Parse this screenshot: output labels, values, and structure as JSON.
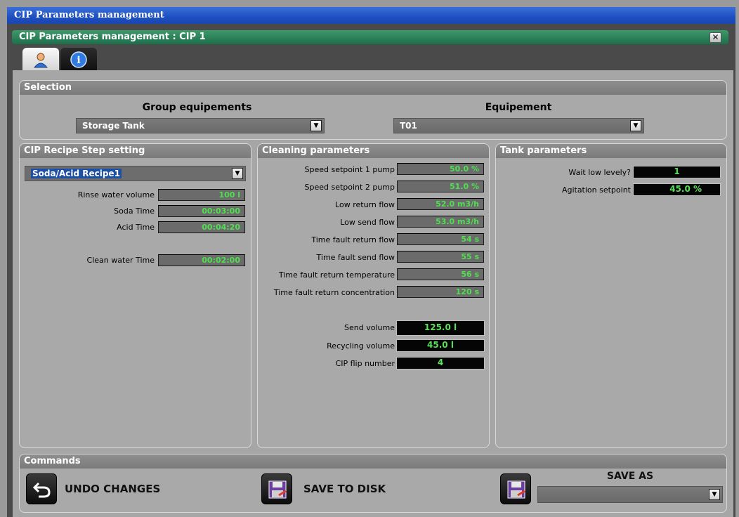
{
  "window": {
    "title": "CIP Parameters management"
  },
  "subheader": {
    "title": "CIP Parameters management : CIP 1",
    "close": "✕"
  },
  "tabs": [
    {
      "icon": "user-icon"
    },
    {
      "icon": "info-icon",
      "glyph": "i"
    }
  ],
  "selection": {
    "title": "Selection",
    "group_label": "Group equipements",
    "group_value": "Storage Tank",
    "equip_label": "Equipement",
    "equip_value": "T01"
  },
  "recipe": {
    "title": "CIP Recipe Step setting",
    "selected": "Soda/Acid Recipe1",
    "rows": [
      {
        "label": "Rinse water volume",
        "value": "100 l"
      },
      {
        "label": "Soda Time",
        "value": "00:03:00"
      },
      {
        "label": "Acid Time",
        "value": "00:04:20"
      },
      {
        "label": "Clean water Time",
        "value": "00:02:00"
      }
    ]
  },
  "cleaning": {
    "title": "Cleaning parameters",
    "rows": [
      {
        "label": "Speed setpoint 1 pump",
        "value": "50.0 %"
      },
      {
        "label": "Speed setpoint 2 pump",
        "value": "51.0 %"
      },
      {
        "label": "Low return flow",
        "value": "52.0 m3/h"
      },
      {
        "label": "Low send flow",
        "value": "53.0 m3/h"
      },
      {
        "label": "Time fault return flow",
        "value": "54 s"
      },
      {
        "label": "Time fault send flow",
        "value": "55 s"
      },
      {
        "label": "Time fault return temperature",
        "value": "56 s"
      },
      {
        "label": "Time fault return concentration",
        "value": "120 s"
      }
    ],
    "readouts": [
      {
        "label": "Send volume",
        "value": "125.0 l"
      },
      {
        "label": "Recycling volume",
        "value": "45.0 l"
      },
      {
        "label": "CIP flip number",
        "value": "4"
      }
    ]
  },
  "tank": {
    "title": "Tank parameters",
    "rows": [
      {
        "label": "Wait low levely?",
        "value": "1"
      },
      {
        "label": "Agitation setpoint",
        "value": "45.0 %"
      }
    ]
  },
  "commands": {
    "title": "Commands",
    "undo": "UNDO CHANGES",
    "save_disk": "SAVE TO DISK",
    "save_as": "SAVE AS",
    "save_as_value": ""
  },
  "colors": {
    "title_blue": "#1e4fc0",
    "header_green": "#1e6e4a",
    "value_green": "#4ee04e"
  }
}
